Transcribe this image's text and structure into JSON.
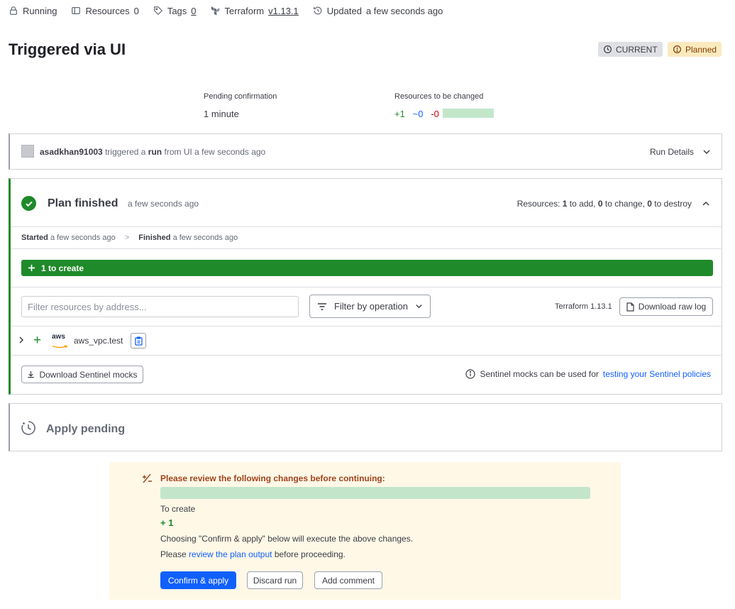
{
  "topbar": {
    "status": "Running",
    "resources_label": "Resources",
    "resources_count": "0",
    "tags_label": "Tags",
    "tags_count": "0",
    "terraform_label": "Terraform",
    "terraform_version": "v1.13.1",
    "updated_label": "Updated",
    "updated_time": "a few seconds ago"
  },
  "header": {
    "title": "Triggered via UI",
    "badge_current": "CURRENT",
    "badge_planned": "Planned"
  },
  "summary": {
    "pending_label": "Pending confirmation",
    "pending_value": "1 minute",
    "resources_label": "Resources to be changed",
    "add": "+1",
    "change": "~0",
    "destroy": "-0"
  },
  "trigger": {
    "user": "asadkhan91003",
    "text_before": "triggered a",
    "run_word": "run",
    "text_after": "from UI a few seconds ago",
    "run_details": "Run Details"
  },
  "plan": {
    "title": "Plan finished",
    "time": "a few seconds ago",
    "resources_prefix": "Resources:",
    "to_add": "1",
    "to_add_label": "to add,",
    "to_change": "0",
    "to_change_label": "to change,",
    "to_destroy": "0",
    "to_destroy_label": "to destroy",
    "started_label": "Started",
    "started_time": "a few seconds ago",
    "finished_label": "Finished",
    "finished_time": "a few seconds ago",
    "create_bar": "1 to create",
    "filter_placeholder": "Filter resources by address...",
    "filter_button": "Filter by operation",
    "terraform_version": "Terraform 1.13.1",
    "download_raw_log": "Download raw log",
    "resource_provider": "aws",
    "resource_name": "aws_vpc.test",
    "download_mocks": "Download Sentinel mocks",
    "sentinel_note": "Sentinel mocks can be used for",
    "sentinel_link": "testing your Sentinel policies"
  },
  "apply": {
    "title": "Apply pending"
  },
  "review": {
    "title": "Please review the following changes before continuing:",
    "to_create_label": "To create",
    "to_create_count": "+ 1",
    "line1": "Choosing \"Confirm & apply\" below will execute the above changes.",
    "line2_before": "Please",
    "line2_link": "review the plan output",
    "line2_after": "before proceeding.",
    "confirm_button": "Confirm & apply",
    "discard_button": "Discard run",
    "comment_button": "Add comment"
  },
  "colors": {
    "success": "#1f8a2a",
    "primary": "#1060ff",
    "warning_bg": "#fff8e7",
    "warning_text": "#a0431b",
    "diff_bar": "#c3e6cb"
  }
}
